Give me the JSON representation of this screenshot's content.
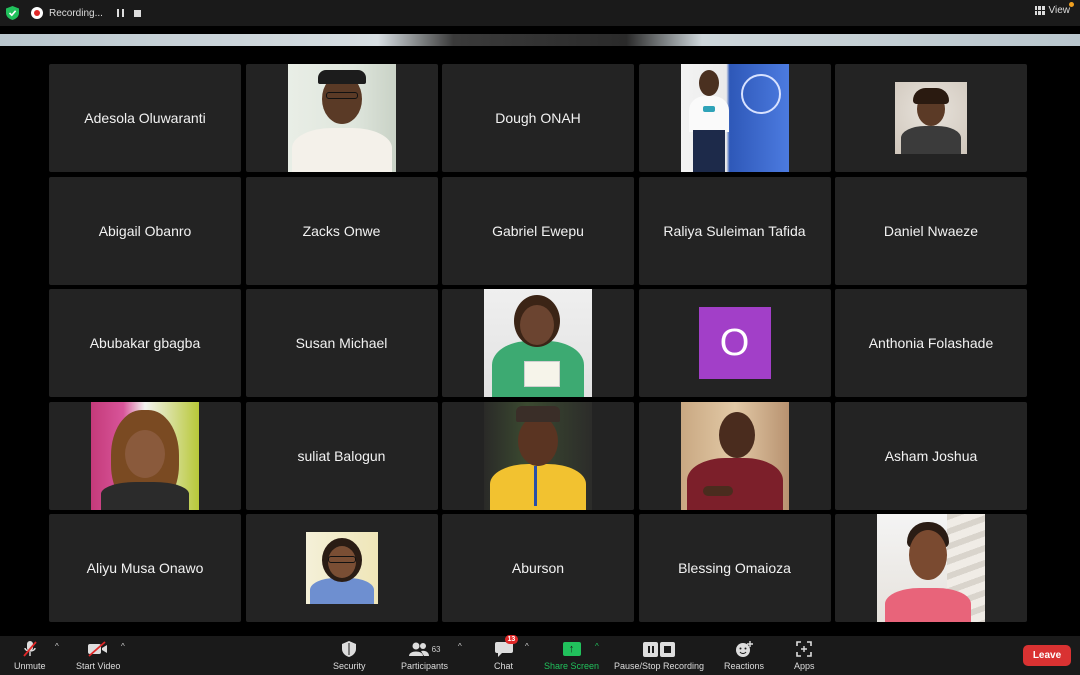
{
  "topbar": {
    "recording_label": "Recording...",
    "view_label": "View"
  },
  "participants": [
    {
      "name": "Adesola Oluwaranti",
      "video": false
    },
    {
      "name": "",
      "video": true,
      "photo": "man-cap"
    },
    {
      "name": "Dough ONAH",
      "video": false
    },
    {
      "name": "",
      "video": true,
      "photo": "woman-flag"
    },
    {
      "name": "",
      "video": true,
      "photo": "woman-pose"
    },
    {
      "name": "Abigail Obanro",
      "video": false
    },
    {
      "name": "Zacks Onwe",
      "video": false
    },
    {
      "name": "Gabriel Ewepu",
      "video": false
    },
    {
      "name": "Raliya Suleiman Tafida",
      "video": false
    },
    {
      "name": "Daniel Nwaeze",
      "video": false
    },
    {
      "name": "Abubakar gbagba",
      "video": false
    },
    {
      "name": "Susan Michael",
      "video": false
    },
    {
      "name": "",
      "video": true,
      "photo": "woman-green"
    },
    {
      "name": "",
      "video": false,
      "avatar_letter": "O",
      "avatar_color": "#a23fc8"
    },
    {
      "name": "Anthonia Folashade",
      "video": false
    },
    {
      "name": "",
      "video": true,
      "photo": "woman-pink"
    },
    {
      "name": "suliat Balogun",
      "video": false
    },
    {
      "name": "",
      "video": true,
      "photo": "man-yellow"
    },
    {
      "name": "",
      "video": true,
      "photo": "man-maroon"
    },
    {
      "name": "Asham Joshua",
      "video": false
    },
    {
      "name": "Aliyu Musa Onawo",
      "video": false
    },
    {
      "name": "",
      "video": true,
      "photo": "woman-glasses"
    },
    {
      "name": "Aburson",
      "video": false
    },
    {
      "name": "Blessing Omaioza",
      "video": false
    },
    {
      "name": "",
      "video": true,
      "photo": "woman-stairs"
    }
  ],
  "toolbar": {
    "unmute": "Unmute",
    "start_video": "Start Video",
    "security": "Security",
    "participants": "Participants",
    "participants_count": "63",
    "chat": "Chat",
    "chat_badge": "13",
    "share_screen": "Share Screen",
    "pause_stop_recording": "Pause/Stop Recording",
    "reactions": "Reactions",
    "apps": "Apps",
    "leave": "Leave"
  },
  "colors": {
    "share_green": "#21c15c",
    "leave_red": "#d93232",
    "tile_bg": "#232323",
    "avatar_purple": "#a23fc8"
  }
}
